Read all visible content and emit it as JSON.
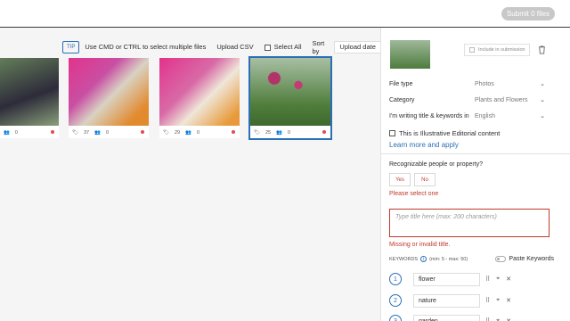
{
  "header": {
    "submit_label": "Submit 0 files"
  },
  "toolbar": {
    "tip": "TIP",
    "hint": "Use CMD or CTRL to select multiple files",
    "upload_csv": "Upload CSV",
    "select_all": "Select All",
    "sort_by": "Sort by",
    "sort_value": "Upload date"
  },
  "thumbnails": [
    {
      "kw": "0",
      "people": "",
      "status_color": "#e54b4b"
    },
    {
      "kw": "37",
      "people": "0",
      "status_color": "#e54b4b"
    },
    {
      "kw": "29",
      "people": "0",
      "status_color": "#e54b4b"
    },
    {
      "kw": "25",
      "people": "0",
      "status_color": "#e54b4b"
    }
  ],
  "panel": {
    "include_label": "Include in submission",
    "file_type_label": "File type",
    "file_type_value": "Photos",
    "category_label": "Category",
    "category_value": "Plants and Flowers",
    "language_label": "I'm writing title & keywords in",
    "language_value": "English",
    "editorial_label": "This is Illustrative Editorial content",
    "learn_more": "Learn more and apply",
    "recognizable_q": "Recognizable people or property?",
    "yes": "Yes",
    "no": "No",
    "select_one": "Please select one",
    "title_placeholder": "Type title here (max: 200 characters)",
    "title_error": "Missing or invalid title.",
    "keywords_label": "KEYWORDS",
    "keywords_range": "(min: 5 - max: 50)",
    "paste_keywords": "Paste Keywords",
    "keywords": [
      {
        "n": "1",
        "text": "flower"
      },
      {
        "n": "2",
        "text": "nature"
      },
      {
        "n": "3",
        "text": "garden"
      }
    ]
  },
  "colors": {
    "accent": "#2c6fb5",
    "error": "#c0392b",
    "submit_disabled": "#c8c8c8"
  }
}
